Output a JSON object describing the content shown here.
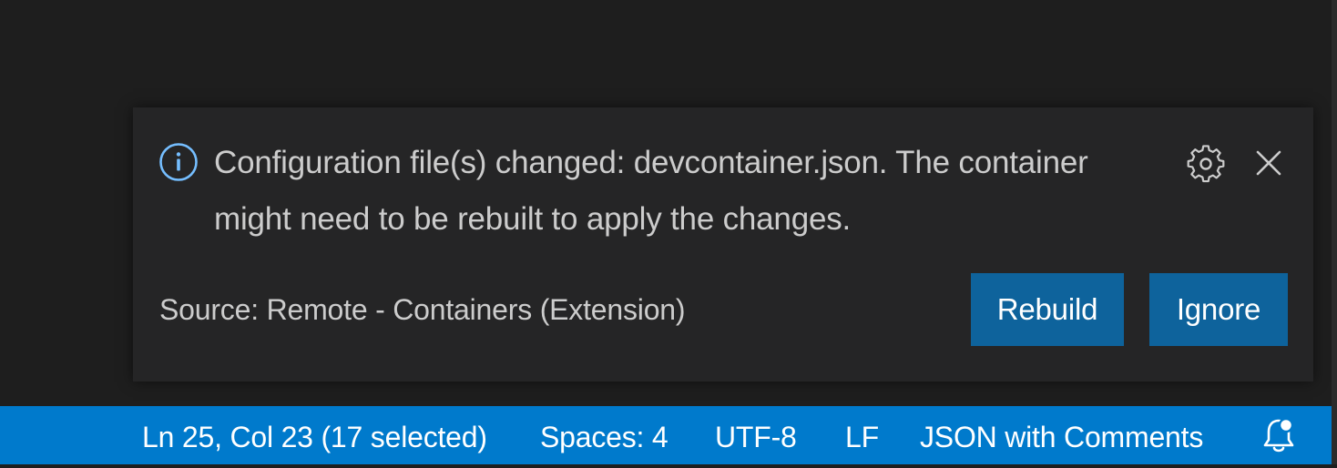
{
  "notification": {
    "message": "Configuration file(s) changed: devcontainer.json. The container might need to be rebuilt to apply the changes.",
    "source": "Source: Remote - Containers (Extension)",
    "icons": {
      "severity": "info-icon",
      "settings": "gear-icon",
      "close": "close-icon"
    },
    "buttons": {
      "rebuild": "Rebuild",
      "ignore": "Ignore"
    },
    "colors": {
      "background": "#252526",
      "info_accent": "#75beff",
      "button": "#0e639c"
    }
  },
  "statusbar": {
    "position": "Ln 25, Col 23 (17 selected)",
    "indentation": "Spaces: 4",
    "encoding": "UTF-8",
    "eol": "LF",
    "language": "JSON with Comments",
    "notifications_icon": "bell-dot-icon",
    "color": "#007acc"
  }
}
